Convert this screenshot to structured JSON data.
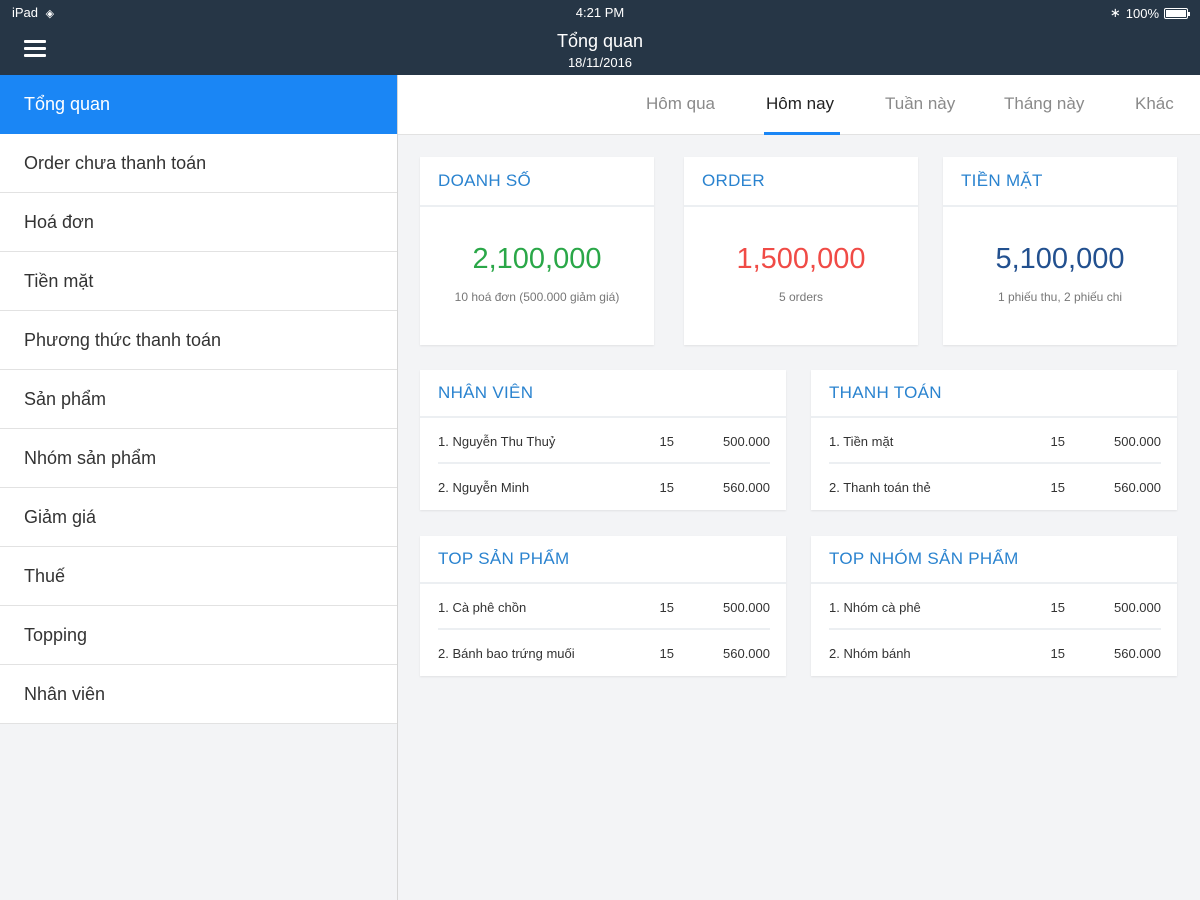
{
  "statusbar": {
    "device": "iPad",
    "time": "4:21 PM",
    "battery": "100%"
  },
  "header": {
    "title": "Tổng quan",
    "date": "18/11/2016"
  },
  "sidebar": {
    "items": [
      {
        "label": "Tổng quan",
        "active": true
      },
      {
        "label": "Order chưa thanh toán"
      },
      {
        "label": "Hoá đơn"
      },
      {
        "label": "Tiền mặt"
      },
      {
        "label": "Phương thức thanh toán"
      },
      {
        "label": "Sản phẩm"
      },
      {
        "label": "Nhóm sản phẩm"
      },
      {
        "label": "Giảm giá"
      },
      {
        "label": "Thuế"
      },
      {
        "label": "Topping"
      },
      {
        "label": "Nhân viên"
      }
    ]
  },
  "tabs": [
    {
      "label": "Hôm qua"
    },
    {
      "label": "Hôm nay",
      "active": true
    },
    {
      "label": "Tuần này"
    },
    {
      "label": "Tháng này"
    },
    {
      "label": "Khác"
    }
  ],
  "stats": [
    {
      "title": "DOANH SỐ",
      "value": "2,100,000",
      "sub": "10 hoá đơn (500.000 giảm giá)",
      "color": "#2aa748"
    },
    {
      "title": "ORDER",
      "value": "1,500,000",
      "sub": "5 orders",
      "color": "#f04b46"
    },
    {
      "title": "TIỀN MẶT",
      "value": "5,100,000",
      "sub": "1 phiếu thu, 2 phiếu chi",
      "color": "#22508f"
    }
  ],
  "panels": [
    {
      "title": "NHÂN VIÊN",
      "rows": [
        {
          "name": "1.  Nguyễn Thu Thuỷ",
          "qty": "15",
          "amount": "500.000"
        },
        {
          "name": "2.  Nguyễn Minh",
          "qty": "15",
          "amount": "560.000"
        }
      ]
    },
    {
      "title": "THANH TOÁN",
      "rows": [
        {
          "name": "1.  Tiền mặt",
          "qty": "15",
          "amount": "500.000"
        },
        {
          "name": "2.  Thanh toán thẻ",
          "qty": "15",
          "amount": "560.000"
        }
      ]
    },
    {
      "title": "TOP SẢN PHẨM",
      "rows": [
        {
          "name": "1.  Cà phê chồn",
          "qty": "15",
          "amount": "500.000"
        },
        {
          "name": "2.  Bánh bao trứng muối",
          "qty": "15",
          "amount": "560.000"
        }
      ]
    },
    {
      "title": "TOP NHÓM SẢN PHẨM",
      "rows": [
        {
          "name": "1.  Nhóm cà phê",
          "qty": "15",
          "amount": "500.000"
        },
        {
          "name": "2.  Nhóm bánh",
          "qty": "15",
          "amount": "560.000"
        }
      ]
    }
  ],
  "colors": {
    "accent": "#1a86f5",
    "header_bg": "#263646",
    "section_title": "#2a83cf"
  },
  "icons": {
    "menu": "hamburger-menu-icon",
    "wifi": "wifi-icon",
    "bluetooth": "bluetooth-icon",
    "battery": "battery-icon"
  }
}
